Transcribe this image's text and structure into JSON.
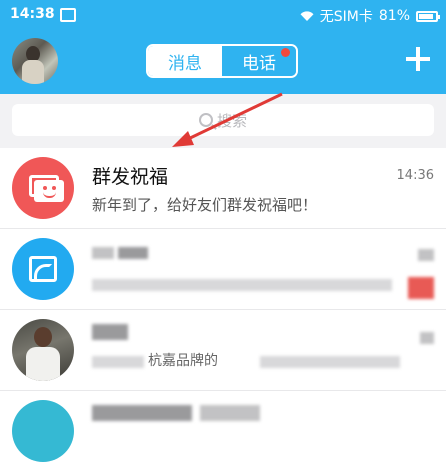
{
  "status_bar": {
    "time": "14:38",
    "carrier": "无SIM卡",
    "battery": "81%",
    "battery_level": 0.81
  },
  "header": {
    "tabs": [
      {
        "label": "消息",
        "active": true
      },
      {
        "label": "电话",
        "active": false,
        "badge_dot": true
      }
    ],
    "add_icon": "plus-icon"
  },
  "search": {
    "placeholder": "搜索"
  },
  "conversations": [
    {
      "name": "群发祝福",
      "message": "新年到了，给好友们群发祝福吧！",
      "time": "14:36",
      "avatar_icon": "broadcast-icon"
    },
    {
      "name": "",
      "message": "",
      "time": "",
      "avatar_icon": "service-icon"
    },
    {
      "name": "",
      "message": "杭嘉品牌的",
      "time": "",
      "avatar_icon": "person-avatar"
    },
    {
      "name": "",
      "message": "",
      "time": "",
      "avatar_icon": "teal-avatar"
    }
  ],
  "colors": {
    "header_blue": "#2fb3f0",
    "badge_red": "#f0493d",
    "broadcast_red": "#f05757",
    "arrow_red": "#e03a36"
  }
}
